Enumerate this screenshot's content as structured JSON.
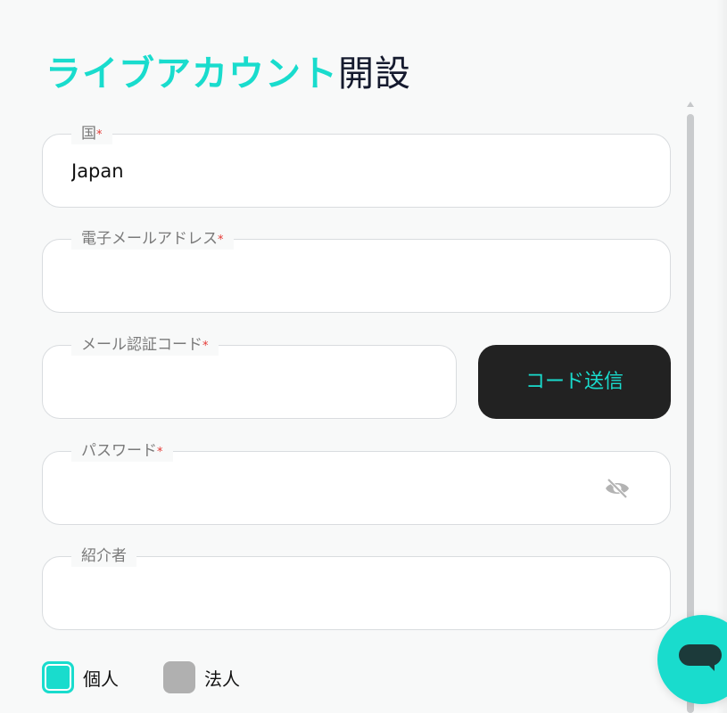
{
  "title": {
    "accent": "ライブアカウント",
    "rest": "開設"
  },
  "fields": {
    "country": {
      "label": "国",
      "required_mark": "*",
      "value": "Japan"
    },
    "email": {
      "label": "電子メールアドレス",
      "required_mark": "*",
      "value": ""
    },
    "code": {
      "label": "メール認証コード",
      "required_mark": "*",
      "value": ""
    },
    "password": {
      "label": "パスワード",
      "required_mark": "*",
      "value": ""
    },
    "referrer": {
      "label": "紹介者",
      "value": ""
    }
  },
  "send_code_button": "コード送信",
  "account_type": {
    "individual": {
      "label": "個人",
      "selected": true
    },
    "corporate": {
      "label": "法人",
      "selected": false
    }
  },
  "icons": {
    "password_toggle": "eye-slash-icon",
    "chat": "chat-bubble-icon"
  },
  "colors": {
    "accent": "#19dccd",
    "dark": "#222222",
    "title_dark": "#151a2e",
    "required": "#e53935"
  }
}
